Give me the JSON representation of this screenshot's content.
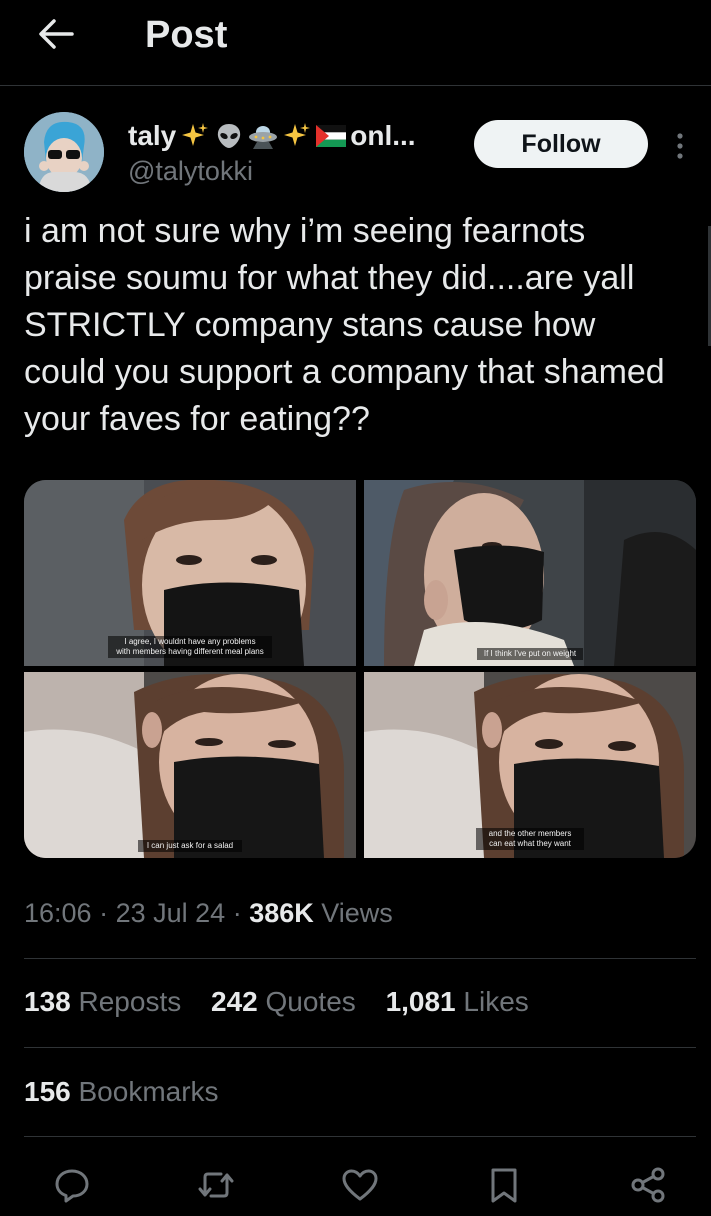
{
  "header": {
    "title": "Post",
    "back_icon": "arrow-left-icon"
  },
  "author": {
    "display_name": "taly",
    "name_suffix": "onl...",
    "name_emojis": [
      "sparkles",
      "alien",
      "ufo",
      "sparkles",
      "palestine-flag"
    ],
    "handle": "@talytokki",
    "follow_label": "Follow",
    "more_icon": "more-vertical-icon"
  },
  "post": {
    "text": "i am not sure why i’m seeing fearnots praise soumu for what they did....are yall STRICTLY company stans cause how could you support a company that shamed your faves for eating??",
    "media": [
      {
        "caption_lines": [
          "I agree, I wouldnt have any problems",
          "with members having different meal plans"
        ]
      },
      {
        "caption_lines": [
          "If I think I've put on weight"
        ]
      },
      {
        "caption_lines": [
          "I can just ask for a salad"
        ]
      },
      {
        "caption_lines": [
          "and the other members",
          "can eat what they want"
        ]
      }
    ]
  },
  "meta": {
    "time": "16:06",
    "date": "23 Jul 24",
    "views_count": "386K",
    "views_label": "Views"
  },
  "stats": {
    "reposts_count": "138",
    "reposts_label": "Reposts",
    "quotes_count": "242",
    "quotes_label": "Quotes",
    "likes_count": "1,081",
    "likes_label": "Likes",
    "bookmarks_count": "156",
    "bookmarks_label": "Bookmarks"
  },
  "actions": [
    "reply-icon",
    "repost-icon",
    "like-icon",
    "bookmark-icon",
    "share-icon"
  ],
  "colors": {
    "background": "#000000",
    "text": "#e7e9ea",
    "secondary": "#71767b",
    "divider": "#2f3336",
    "follow_bg": "#eff3f4"
  }
}
